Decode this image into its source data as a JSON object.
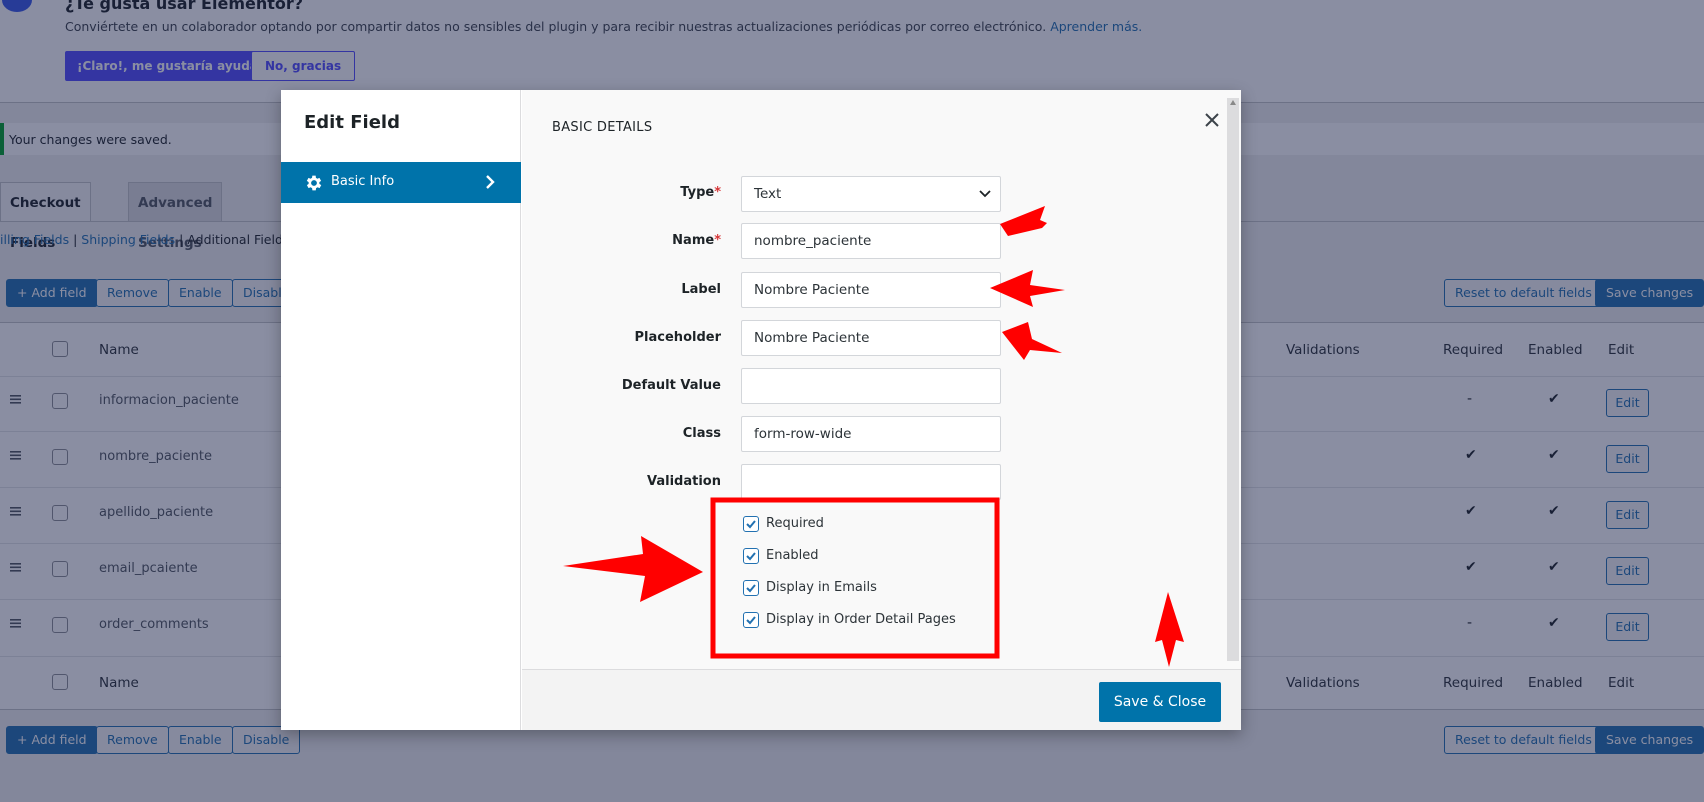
{
  "notice": {
    "title": "¿Te gusta usar Elementor?",
    "text": "Conviértete en un colaborador optando por compartir datos no sensibles del plugin y para recibir nuestras actualizaciones periódicas por correo electrónico.",
    "link": "Aprender más.",
    "accept_label": "¡Claro!, me gustaría ayudar",
    "decline_label": "No, gracias"
  },
  "saved_message": "Your changes were saved.",
  "tabs": [
    {
      "label": "Checkout Fields"
    },
    {
      "label": "Advanced Settings"
    }
  ],
  "subsections": {
    "billing": "illing Fields",
    "sep1": " | ",
    "shipping": "Shipping Fields",
    "sep2": " | ",
    "additional": "Additional Fields"
  },
  "toolbar": {
    "add_field": "+ Add field",
    "remove": "Remove",
    "enable": "Enable",
    "disable": "Disable",
    "reset": "Reset to default fields",
    "save": "Save changes"
  },
  "table": {
    "columns": {
      "name": "Name",
      "validations": "Validations",
      "required": "Required",
      "enabled": "Enabled",
      "edit": "Edit"
    },
    "rows": [
      {
        "name": "informacion_paciente",
        "required": "-",
        "enabled": "✔",
        "edit": "Edit"
      },
      {
        "name": "nombre_paciente",
        "required": "✔",
        "enabled": "✔",
        "edit": "Edit"
      },
      {
        "name": "apellido_paciente",
        "required": "✔",
        "enabled": "✔",
        "edit": "Edit"
      },
      {
        "name": "email_pcaiente",
        "required": "✔",
        "enabled": "✔",
        "edit": "Edit"
      },
      {
        "name": "order_comments",
        "required": "-",
        "enabled": "✔",
        "edit": "Edit"
      }
    ]
  },
  "modal": {
    "title": "Edit Field",
    "sidebar_item": "Basic Info",
    "section_title": "BASIC DETAILS",
    "fields": {
      "type_label": "Type",
      "type_value": "Text",
      "name_label": "Name",
      "name_value": "nombre_paciente",
      "label_label": "Label",
      "label_value": "Nombre Paciente",
      "placeholder_label": "Placeholder",
      "placeholder_value": "Nombre Paciente",
      "default_label": "Default Value",
      "default_value": "",
      "class_label": "Class",
      "class_value": "form-row-wide",
      "validation_label": "Validation",
      "validation_value": ""
    },
    "required_mark": "*",
    "checkboxes": [
      {
        "label": "Required",
        "checked": true
      },
      {
        "label": "Enabled",
        "checked": true
      },
      {
        "label": "Display in Emails",
        "checked": true
      },
      {
        "label": "Display in Order Detail Pages",
        "checked": true
      }
    ],
    "save_close": "Save & Close"
  },
  "colors": {
    "primary": "#0073aa",
    "annotation": "#ff0000",
    "elementor_purple": "#524cff"
  }
}
